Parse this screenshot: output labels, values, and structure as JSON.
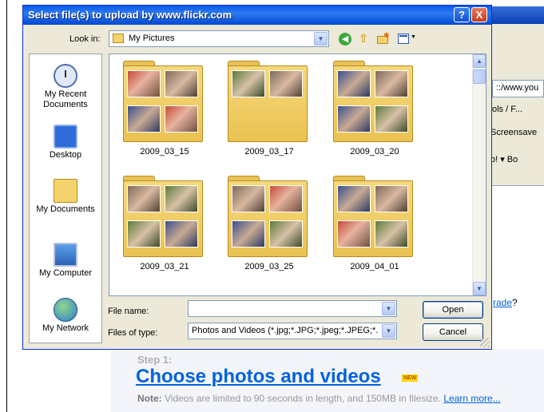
{
  "dialog": {
    "title": "Select file(s) to upload by www.flickr.com",
    "help_label": "?",
    "close_label": "X",
    "look_in_label": "Look in:",
    "look_in_value": "My Pictures",
    "places": [
      {
        "label": "My Recent Documents",
        "icon": "recent-documents-icon"
      },
      {
        "label": "Desktop",
        "icon": "desktop-icon"
      },
      {
        "label": "My Documents",
        "icon": "my-documents-icon"
      },
      {
        "label": "My Computer",
        "icon": "my-computer-icon"
      },
      {
        "label": "My Network",
        "icon": "my-network-icon"
      }
    ],
    "folders": [
      {
        "name": "2009_03_15"
      },
      {
        "name": "2009_03_17"
      },
      {
        "name": "2009_03_20"
      },
      {
        "name": "2009_03_21"
      },
      {
        "name": "2009_03_25"
      },
      {
        "name": "2009_04_01"
      }
    ],
    "file_name_label": "File name:",
    "file_name_value": "",
    "files_of_type_label": "Files of type:",
    "files_of_type_value": "Photos and Videos (*.jpg;*.JPG;*.jpeg;*.JPEG;*.",
    "open_button": "Open",
    "cancel_button": "Cancel"
  },
  "background": {
    "url_fragment": "::/www.you",
    "tools_fragment": "ols / F...",
    "screensaver_fragment": "Screensave",
    "bo_fragment": "o! ▾ Bo",
    "upgrade_link": "rade",
    "upgrade_suffix": "?",
    "step_label": "Step 1:",
    "heading": "Choose photos and videos",
    "new_badge": "NEW",
    "note_prefix": "Note:",
    "note_text": " Videos are limited to 90 seconds in length, and 150MB in filesize. ",
    "learn_more": "Learn more..."
  },
  "colors": {
    "titlebar": "#0a5ae8",
    "dialog_face": "#ece9d8",
    "link_blue": "#0063dc",
    "folder_yellow": "#f6d97c"
  }
}
